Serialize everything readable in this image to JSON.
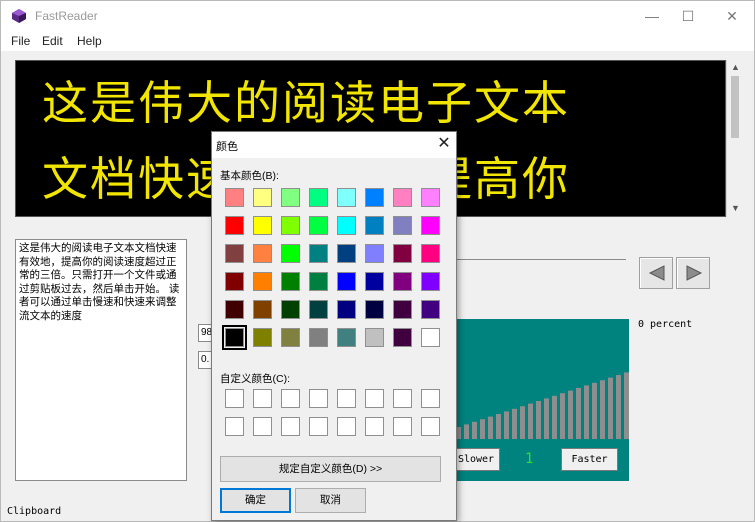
{
  "window": {
    "title": "FastReader",
    "controls": {
      "minimize": "—",
      "maximize": "☐",
      "close": "✕"
    }
  },
  "menu": [
    "File",
    "Edit",
    "Help"
  ],
  "display": {
    "lines": [
      "这是伟大的阅读电子文本",
      "文档快速有效地，提高你"
    ],
    "text_color": "#f2e600",
    "background": "#000000"
  },
  "source_text": "这是伟大的阅读电子文本文档快速有效地，提高你的阅读速度超过正常的三倍。只需打开一个文件或通过剪贴板过去，然后单击开始。 读者可以通过单击慢速和快速来调整流文本的速度",
  "inputs": {
    "field1": "98",
    "field2": "0."
  },
  "navigation": {
    "prev_icon": "left-arrow-icon",
    "next_icon": "right-arrow-icon"
  },
  "progress": {
    "label": "0 percent"
  },
  "speed": {
    "slower_label": "Slower",
    "faster_label": "Faster",
    "value": "1",
    "panel_color": "#00827f",
    "bar_count": 22
  },
  "status_bar": "Clipboard",
  "color_dialog": {
    "title": "颜色",
    "basic_colors_label": "基本颜色(B):",
    "custom_colors_label": "自定义颜色(C):",
    "define_custom_button": "规定自定义颜色(D) >>",
    "ok_button": "确定",
    "cancel_button": "取消",
    "basic_colors": [
      [
        "#ff8080",
        "#ffff80",
        "#80ff80",
        "#00ff80",
        "#80ffff",
        "#0080ff",
        "#ff80c0",
        "#ff80ff"
      ],
      [
        "#ff0000",
        "#ffff00",
        "#80ff00",
        "#00ff40",
        "#00ffff",
        "#0080c0",
        "#8080c0",
        "#ff00ff"
      ],
      [
        "#804040",
        "#ff8040",
        "#00ff00",
        "#008080",
        "#004080",
        "#8080ff",
        "#800040",
        "#ff0080"
      ],
      [
        "#800000",
        "#ff8000",
        "#008000",
        "#008040",
        "#0000ff",
        "#0000a0",
        "#800080",
        "#8000ff"
      ],
      [
        "#400000",
        "#804000",
        "#004000",
        "#004040",
        "#000080",
        "#000040",
        "#400040",
        "#400080"
      ],
      [
        "#000000",
        "#808000",
        "#808040",
        "#808080",
        "#408080",
        "#c0c0c0",
        "#400040",
        "#ffffff"
      ]
    ],
    "selected_color": "#000000",
    "custom_rows": 2,
    "custom_cols": 8
  }
}
